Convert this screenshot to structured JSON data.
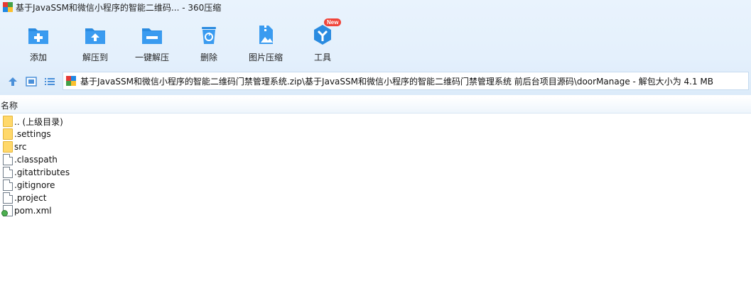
{
  "window": {
    "title": "基于JavaSSM和微信小程序的智能二维码... - 360压缩"
  },
  "toolbar": {
    "items": [
      {
        "label": "添加",
        "icon": "add-icon"
      },
      {
        "label": "解压到",
        "icon": "extract-to-icon"
      },
      {
        "label": "一键解压",
        "icon": "one-click-extract-icon"
      },
      {
        "label": "删除",
        "icon": "delete-icon"
      },
      {
        "label": "图片压缩",
        "icon": "image-compress-icon"
      },
      {
        "label": "工具",
        "icon": "tools-icon",
        "badge": "New"
      }
    ]
  },
  "address": {
    "path": "基于JavaSSM和微信小程序的智能二维码门禁管理系统.zip\\基于JavaSSM和微信小程序的智能二维码门禁管理系统 前后台项目源码\\doorManage - 解包大小为 4.1 MB"
  },
  "list": {
    "column_name": "名称",
    "items": [
      {
        "name": ".. (上级目录)",
        "type": "folder"
      },
      {
        "name": ".settings",
        "type": "folder"
      },
      {
        "name": "src",
        "type": "folder"
      },
      {
        "name": ".classpath",
        "type": "file"
      },
      {
        "name": ".gitattributes",
        "type": "file"
      },
      {
        "name": ".gitignore",
        "type": "file"
      },
      {
        "name": ".project",
        "type": "file"
      },
      {
        "name": "pom.xml",
        "type": "xml"
      }
    ]
  },
  "colors": {
    "accent": "#2a8be0",
    "badge": "#f0453a",
    "folder": "#ffd86a"
  }
}
